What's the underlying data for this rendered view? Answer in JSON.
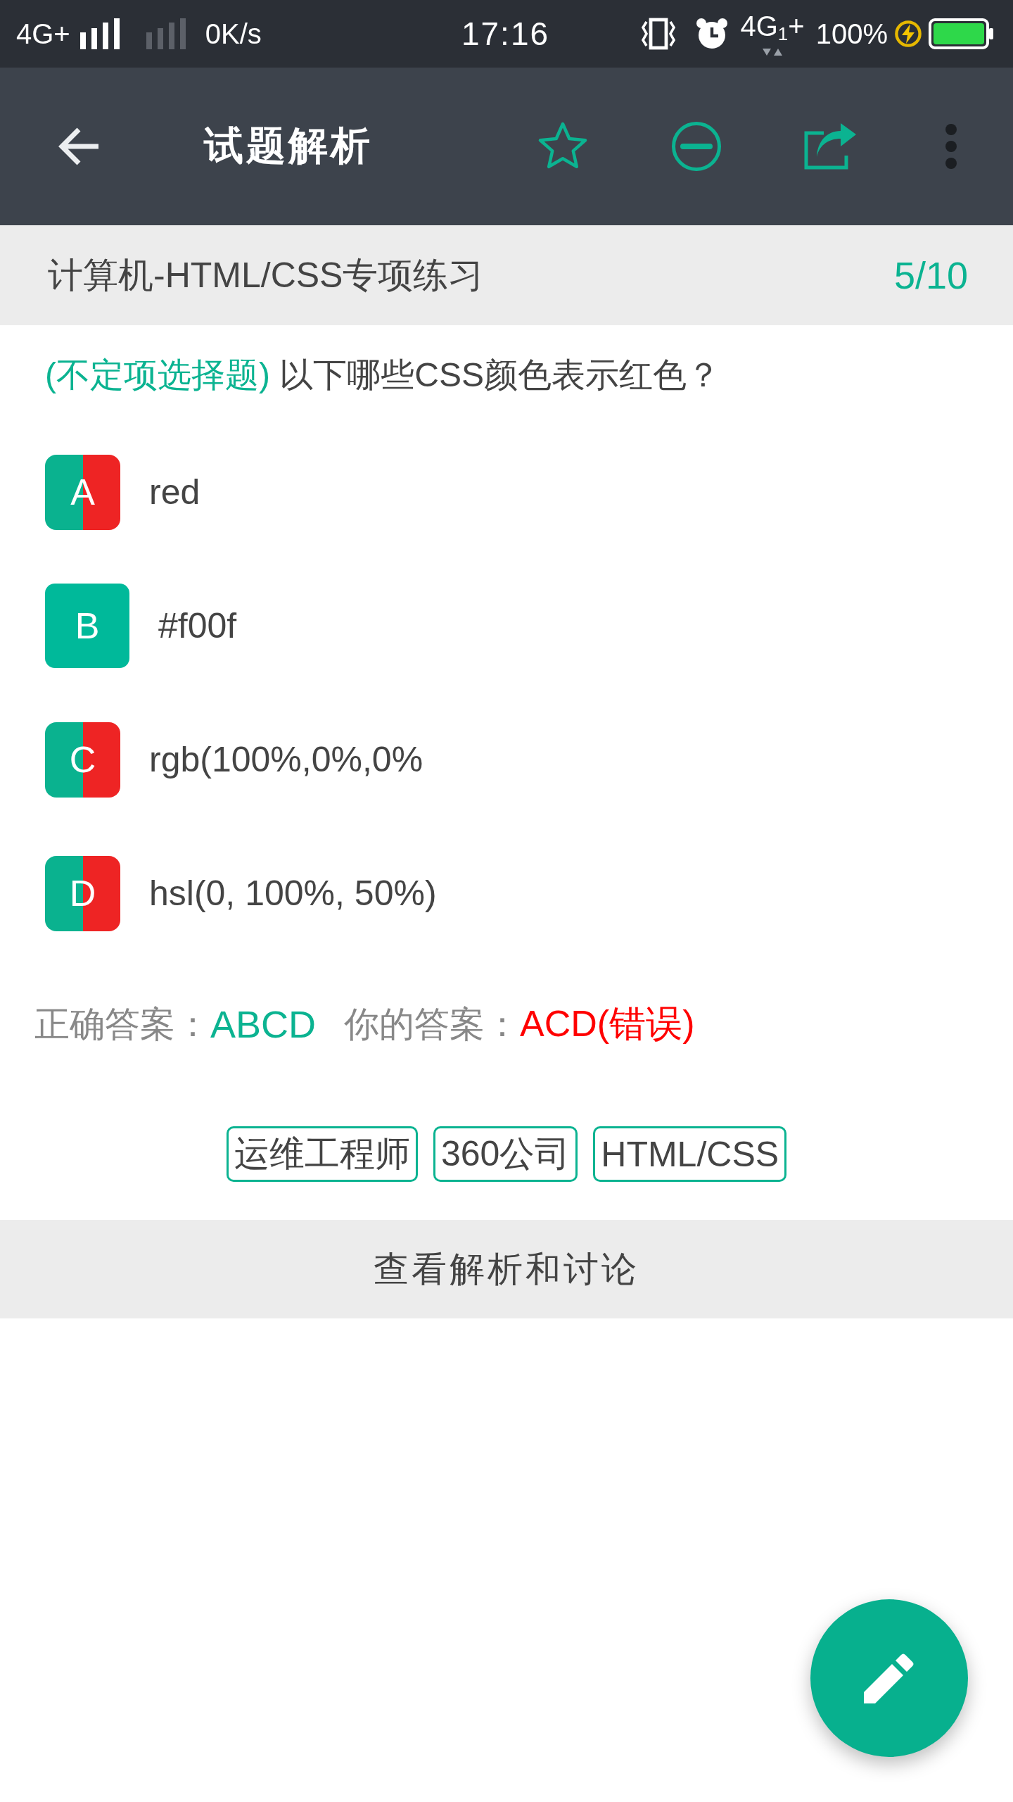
{
  "status_bar": {
    "network": "4G+",
    "speed": "0K/s",
    "time": "17:16",
    "network_2": "4G$_{1}$+",
    "battery": "100%"
  },
  "toolbar": {
    "title": "试题解析"
  },
  "header": {
    "title": "计算机-HTML/CSS专项练习",
    "progress": "5/10"
  },
  "question": {
    "type": "(不定项选择题)",
    "text": "以下哪些CSS颜色表示红色？"
  },
  "options": [
    {
      "letter": "A",
      "text": "red",
      "selected": true
    },
    {
      "letter": "B",
      "text": "#f00f",
      "selected": false
    },
    {
      "letter": "C",
      "text": "rgb(100%,0%,0%",
      "selected": true
    },
    {
      "letter": "D",
      "text": "hsl(0, 100%, 50%)",
      "selected": true
    }
  ],
  "answer": {
    "correct_label": "正确答案：",
    "correct_value": "ABCD",
    "your_label": "你的答案：",
    "your_value": "ACD(错误)",
    "your_value_right": false
  },
  "tags": [
    "运维工程师",
    "360公司",
    "HTML/CSS"
  ],
  "action": "查看解析和讨论"
}
